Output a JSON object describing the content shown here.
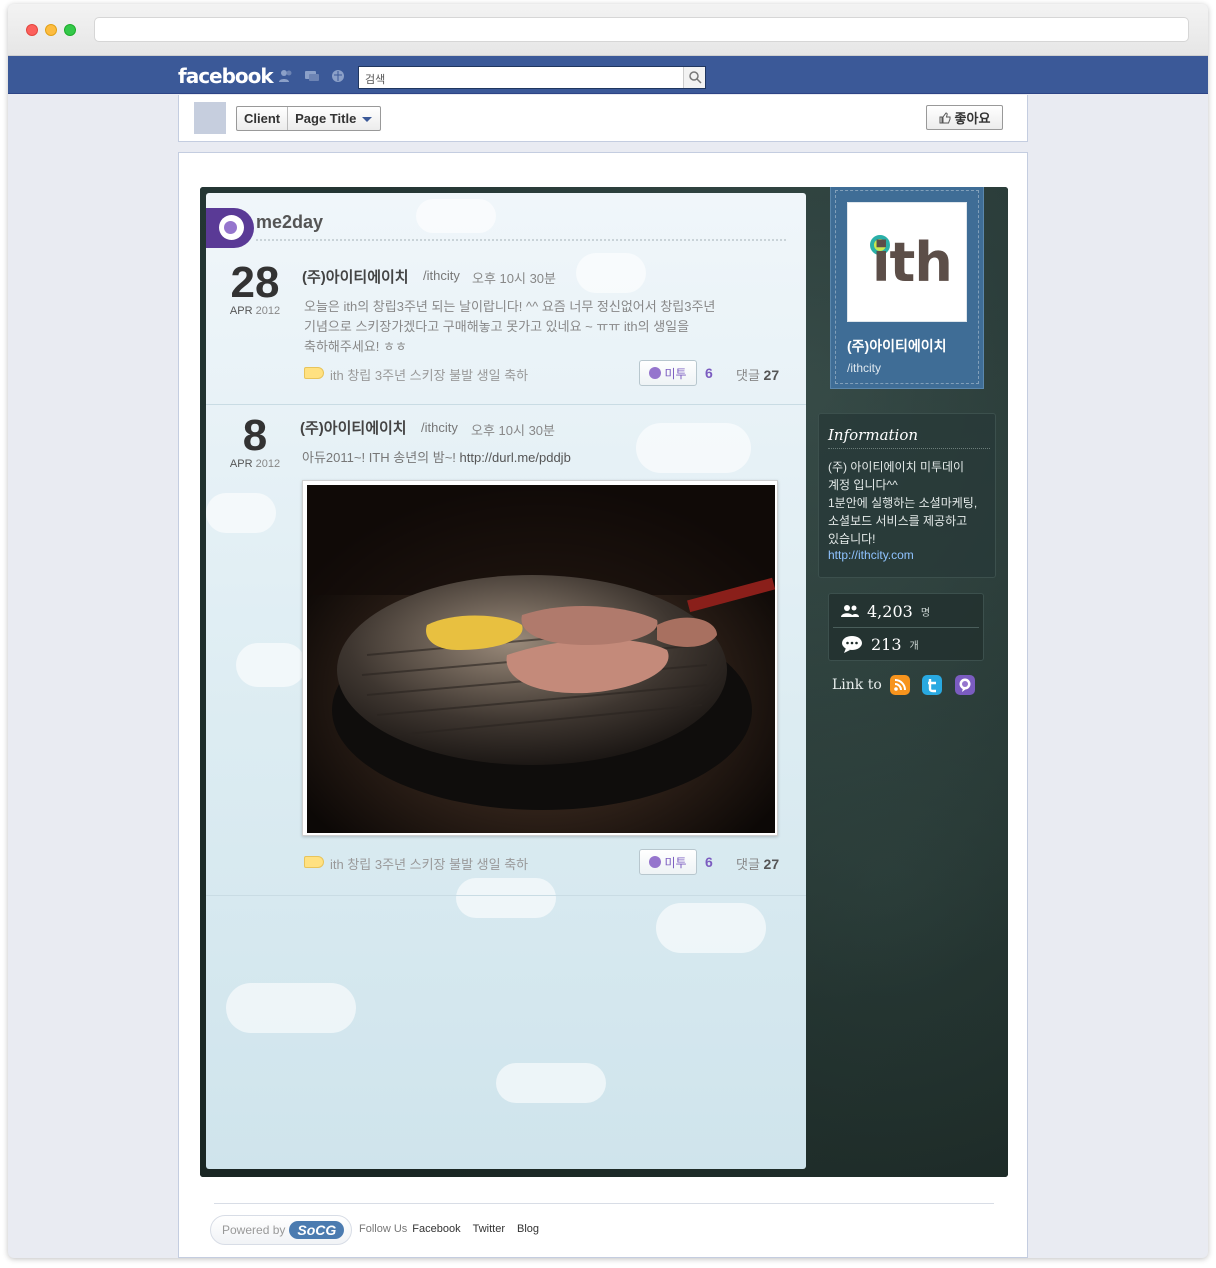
{
  "facebook": {
    "logo": "facebook",
    "search_placeholder": "검색",
    "icons": [
      "friends-icon",
      "messages-icon",
      "notifications-icon",
      "search-icon"
    ]
  },
  "page_header": {
    "crumb_client": "Client",
    "crumb_page_title": "Page Title",
    "like_label": "좋아요"
  },
  "feed": {
    "service": "me2day",
    "posts": [
      {
        "day": "28",
        "month": "APR",
        "year": "2012",
        "author": "(주)아이티에이치",
        "handle": "/ithcity",
        "time": "오후 10시 30분",
        "body_line1": "오늘은 ith의 창립3주년 되는 날이랍니다! ^^ 요즘 너무 정신없어서 창립3주년",
        "body_line2": "기념으로 스키장가겠다고 구매해놓고 못가고 있네요 ~ ㅠㅠ ith의 생일을",
        "body_line3": "축하해주세요! ㅎㅎ",
        "tags": "ith 창립 3주년 스키장 불발 생일 축하",
        "metoo_label": "미투",
        "metoo_count": "6",
        "reply_label": "댓글",
        "reply_count": "27"
      },
      {
        "day": "8",
        "month": "APR",
        "year": "2012",
        "author": "(주)아이티에이치",
        "handle": "/ithcity",
        "time": "오후 10시 30분",
        "body_text": "아듀2011~! ITH 송년의 밤~! ",
        "body_link": "http://durl.me/pddjb",
        "tags": "ith 창립 3주년 스키장 불발 생일 축하",
        "metoo_label": "미투",
        "metoo_count": "6",
        "reply_label": "댓글",
        "reply_count": "27"
      }
    ]
  },
  "profile": {
    "logo_text": "ith",
    "name": "(주)아이티에이치",
    "handle": "/ithcity"
  },
  "information": {
    "title": "Information",
    "line1": "(주) 아이티에이치 미투데이",
    "line2": "계정 입니다^^",
    "line3": "1분안에 실행하는 소셜마케팅,",
    "line4": "소셜보드 서비스를 제공하고",
    "line5": "있습니다!",
    "link": "http://ithcity.com"
  },
  "stats": {
    "followers": "4,203",
    "followers_unit": "명",
    "posts": "213",
    "posts_unit": "개"
  },
  "links": {
    "label": "Link to",
    "items": [
      "rss-icon",
      "twitter-icon",
      "me2day-icon"
    ]
  },
  "footer": {
    "powered_by": "Powered by",
    "brand": "SoCG",
    "follow_us": "Follow Us",
    "facebook": "Facebook",
    "twitter": "Twitter",
    "blog": "Blog"
  },
  "colors": {
    "facebook_blue": "#3b5998",
    "me2day_purple": "#5a3a96",
    "profile_blue": "#3f6d96",
    "dark_panel": "#1d2b29"
  }
}
